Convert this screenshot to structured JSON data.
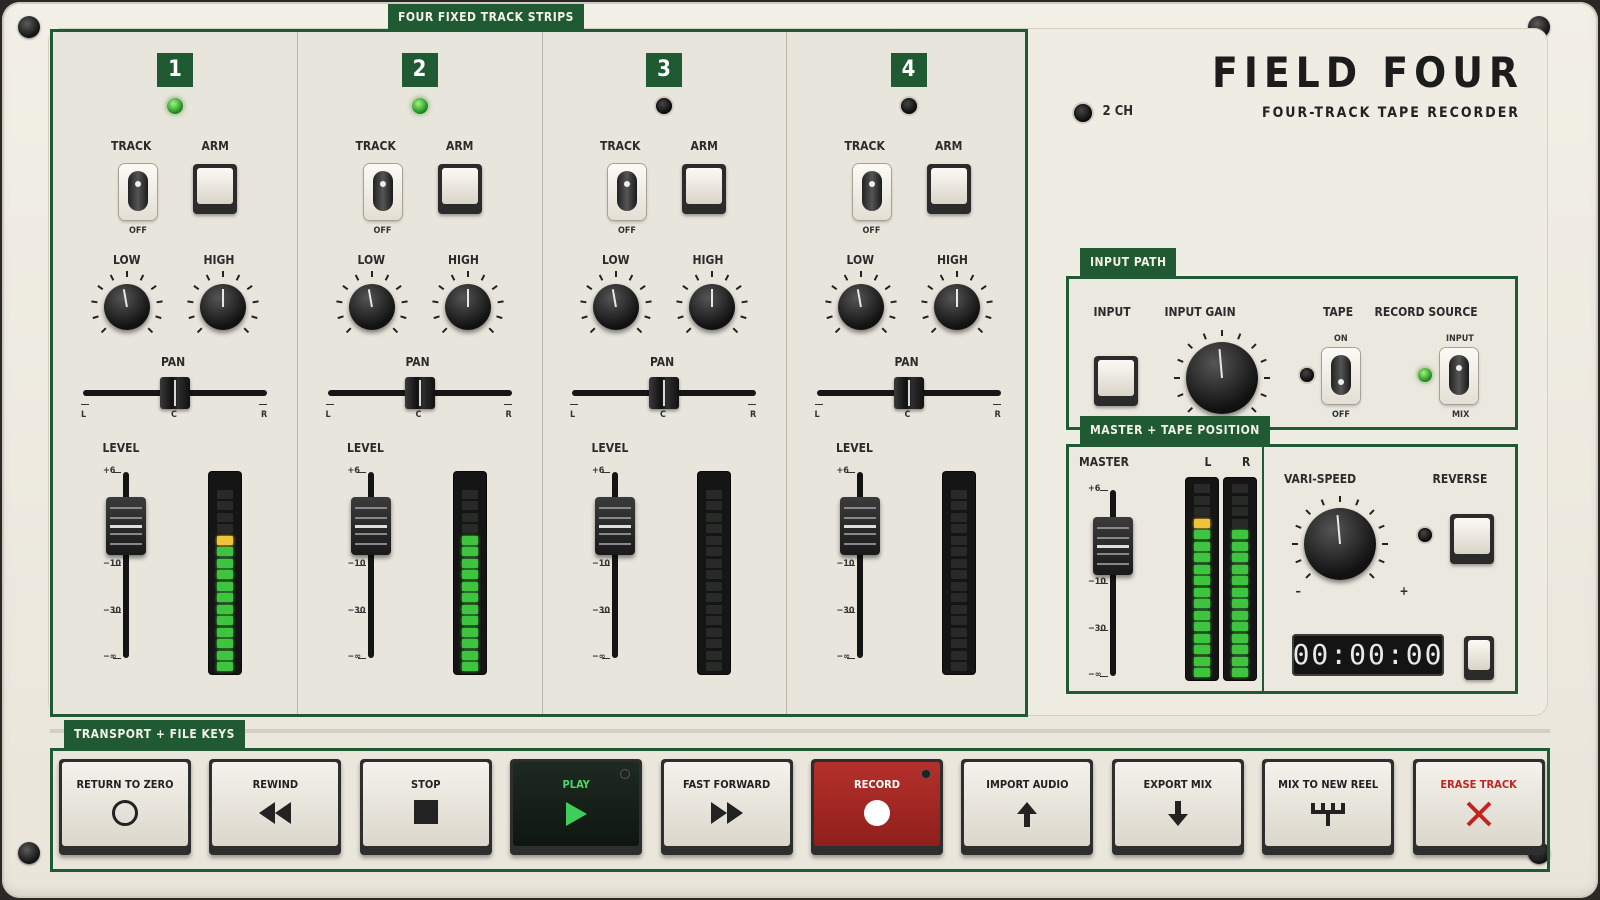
{
  "brand": {
    "name": "FIELD FOUR",
    "subtitle": "FOUR-TRACK TAPE RECORDER",
    "channel_label": "2 CH"
  },
  "sections": {
    "strips": "FOUR FIXED TRACK STRIPS",
    "input_path": "INPUT PATH",
    "master": "MASTER + TAPE POSITION",
    "transport": "TRANSPORT + FILE KEYS"
  },
  "strip_labels": {
    "track": "TRACK",
    "arm": "ARM",
    "off": "OFF",
    "low": "LOW",
    "high": "HIGH",
    "pan": "PAN",
    "pan_l": "L",
    "pan_c": "C",
    "pan_r": "R",
    "level": "LEVEL"
  },
  "fader_scale": [
    "+6",
    "−10",
    "−30",
    "−∞"
  ],
  "tracks": [
    {
      "number": "1",
      "led_on": true,
      "meter_green": 11,
      "meter_yellow": 1
    },
    {
      "number": "2",
      "led_on": true,
      "meter_green": 12,
      "meter_yellow": 0
    },
    {
      "number": "3",
      "led_on": false,
      "meter_green": 0,
      "meter_yellow": 0
    },
    {
      "number": "4",
      "led_on": false,
      "meter_green": 0,
      "meter_yellow": 0
    }
  ],
  "input_path": {
    "input": "INPUT",
    "input_gain": "INPUT GAIN",
    "tape": "TAPE",
    "tape_on": "ON",
    "tape_off": "OFF",
    "record_source": "RECORD SOURCE",
    "rs_input": "INPUT",
    "rs_mix": "MIX"
  },
  "master": {
    "master": "MASTER",
    "l": "L",
    "r": "R",
    "vari_speed": "VARI-SPEED",
    "minus": "–",
    "plus": "+",
    "reverse": "REVERSE",
    "counter": "00:00:00",
    "l_green": 13,
    "l_yellow": 1,
    "r_green": 13,
    "r_yellow": 0
  },
  "transport": [
    {
      "label": "RETURN TO ZERO",
      "icon": "circle-icon"
    },
    {
      "label": "REWIND",
      "icon": "rewind-icon"
    },
    {
      "label": "STOP",
      "icon": "stop-icon"
    },
    {
      "label": "PLAY",
      "icon": "play-icon"
    },
    {
      "label": "FAST FORWARD",
      "icon": "fast-forward-icon"
    },
    {
      "label": "RECORD",
      "icon": "record-icon"
    },
    {
      "label": "IMPORT AUDIO",
      "icon": "arrow-up-icon"
    },
    {
      "label": "EXPORT MIX",
      "icon": "arrow-down-icon"
    },
    {
      "label": "MIX TO NEW REEL",
      "icon": "merge-icon"
    },
    {
      "label": "ERASE TRACK",
      "icon": "x-icon"
    }
  ]
}
